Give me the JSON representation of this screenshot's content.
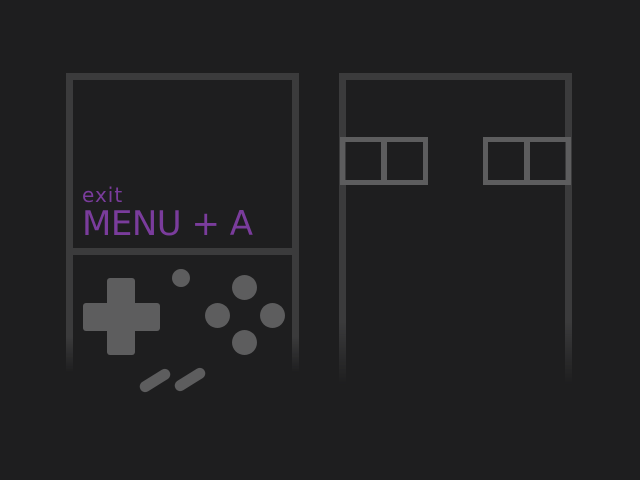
{
  "hint": {
    "label": "exit",
    "combo": "MENU + A"
  },
  "colors": {
    "background": "#1e1e1f",
    "frame": "#3b3b3c",
    "controls": "#5d5d5e",
    "accent": "#7a3c9c"
  },
  "icons": {
    "handheld": "game-console-outline",
    "dpad": "dpad-icon",
    "buttons": "face-buttons-icon",
    "window": "window-pane-icon"
  }
}
